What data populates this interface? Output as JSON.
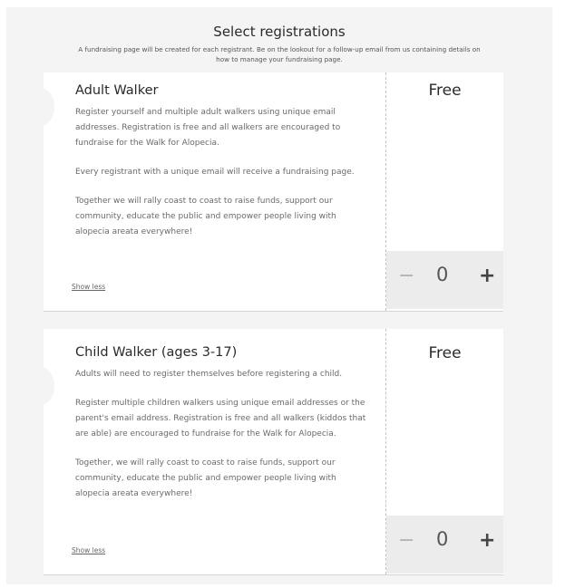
{
  "header": {
    "title": "Select registrations",
    "subtitle": "A fundraising page will be created for each registrant. Be on the lookout for a follow-up email from us containing details on how to manage your fundraising page."
  },
  "registrations": [
    {
      "name": "Adult Walker",
      "price": "Free",
      "description": [
        "Register yourself and multiple adult walkers using unique email addresses. Registration is free and all walkers are encouraged to fundraise for the Walk for Alopecia.",
        "Every registrant with a unique email will receive a fundraising page.",
        "Together we will rally coast to coast to raise funds, support our community, educate the public and empower people living with alopecia areata everywhere!"
      ],
      "toggle_label": "Show less",
      "quantity": "0"
    },
    {
      "name": "Child Walker (ages 3-17)",
      "price": "Free",
      "description": [
        "Adults will need to register themselves before registering a child.",
        "Register multiple children walkers using unique email addresses or the parent's email address. Registration is free and all walkers (kiddos that are able) are encouraged to fundraise for the Walk for Alopecia.",
        "Together, we will rally coast to coast to raise funds, support our community, educate the public and empower people living with alopecia areata everywhere!"
      ],
      "toggle_label": "Show less",
      "quantity": "0"
    }
  ],
  "icons": {
    "decrement": "minus-icon",
    "increment": "plus-icon"
  }
}
